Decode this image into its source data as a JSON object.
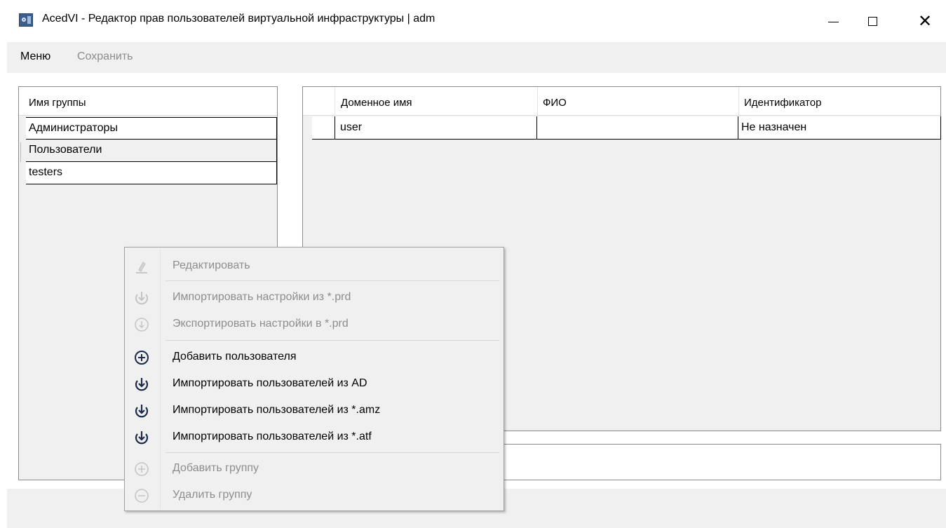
{
  "window": {
    "title": "AcedVI - Редактор прав пользователей виртуальной инфраструктуры | adm",
    "close_glyph": "✕"
  },
  "menubar": {
    "menu_label": "Меню",
    "save_label": "Сохранить"
  },
  "groups": {
    "header": "Имя группы",
    "rows": [
      "Администраторы",
      "Пользователи",
      "testers"
    ],
    "selected_index": 1
  },
  "users": {
    "columns": [
      "Доменное имя",
      "ФИО",
      "Идентификатор"
    ],
    "rows": [
      {
        "domain_name": "user",
        "fio": "",
        "identifier": "Не назначен"
      }
    ]
  },
  "context_menu": {
    "items": [
      {
        "label": "Редактировать",
        "icon": "pencil-icon",
        "enabled": false
      },
      {
        "label": "Импортировать настройки из *.prd",
        "icon": "import-icon",
        "enabled": false
      },
      {
        "label": "Экспортировать настройки в *.prd",
        "icon": "export-icon",
        "enabled": false
      },
      {
        "label": "Добавить пользователя",
        "icon": "add-circle-icon",
        "enabled": true
      },
      {
        "label": "Импортировать пользователей из AD",
        "icon": "import-icon",
        "enabled": true
      },
      {
        "label": "Импортировать пользователей из *.amz",
        "icon": "import-icon",
        "enabled": true
      },
      {
        "label": "Импортировать пользователей из *.atf",
        "icon": "import-icon",
        "enabled": true
      },
      {
        "label": "Добавить группу",
        "icon": "add-circle-icon",
        "enabled": false
      },
      {
        "label": "Удалить группу",
        "icon": "remove-circle-icon",
        "enabled": false
      }
    ]
  },
  "colors": {
    "menubar_bg": "#f0f0f0",
    "disabled_text": "#8d8d8d",
    "enabled_icon": "#1b2a4a",
    "disabled_icon": "#c4c4c4",
    "selection_mark": "#9ac3e6"
  }
}
